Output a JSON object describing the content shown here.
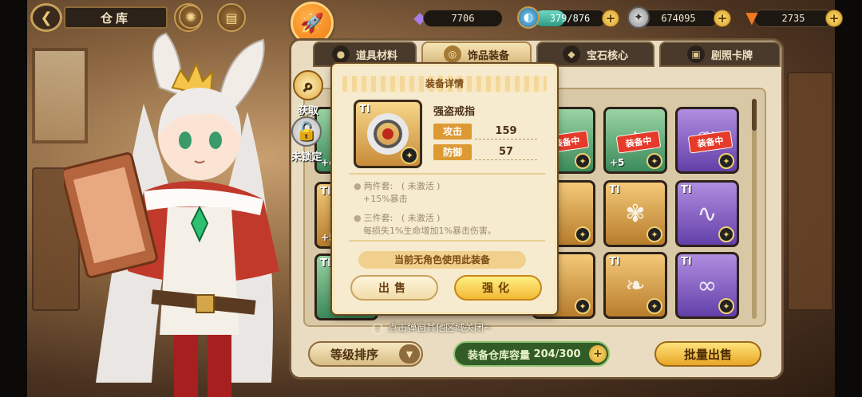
{
  "header": {
    "title": "仓库",
    "back_icon": "back-arrow-icon"
  },
  "resources": {
    "gem": {
      "icon": "purple-crystal-icon",
      "value": "7706"
    },
    "stamina": {
      "icon": "potion-icon",
      "value": "379/876",
      "fill_fraction": 0.43
    },
    "coin": {
      "icon": "silver-coin-icon",
      "value": "674095"
    },
    "carrot": {
      "icon": "carrot-icon",
      "value": "2735"
    }
  },
  "tabs": [
    {
      "label": "道具材料",
      "active": false
    },
    {
      "label": "饰品装备",
      "active": true
    },
    {
      "label": "宝石核心",
      "active": false
    },
    {
      "label": "剧照卡牌",
      "active": false
    }
  ],
  "side_actions": [
    {
      "label": "获取",
      "icon": "magnifier-icon"
    },
    {
      "label": "未锁定",
      "icon": "unlock-icon"
    }
  ],
  "slots": [
    {
      "tier": "TI",
      "color": "green",
      "equipped": "",
      "level": "",
      "icon": "bow-icon"
    },
    {
      "tier": "TI",
      "color": "green",
      "equipped": "装备中",
      "level": "",
      "icon": "leaf-crown-icon"
    },
    {
      "tier": "TI",
      "color": "green",
      "equipped": "装备中",
      "level": "+5",
      "icon": "dragon-icon"
    },
    {
      "tier": "TI",
      "color": "purple",
      "equipped": "装备中",
      "level": "",
      "icon": "horn-icon"
    },
    {
      "tier": "TI",
      "color": "gold",
      "equipped": "",
      "level": "",
      "icon": "ring-icon"
    },
    {
      "tier": "TI",
      "color": "gold",
      "equipped": "",
      "level": "",
      "icon": "fox-icon"
    },
    {
      "tier": "TI",
      "color": "purple",
      "equipped": "",
      "level": "",
      "icon": "serpent-icon"
    },
    {
      "tier": "TI",
      "color": "gold",
      "equipped": "",
      "level": "",
      "icon": "feather-icon"
    },
    {
      "tier": "TI",
      "color": "green",
      "equipped": "",
      "level": "",
      "icon": "leaf-icon"
    },
    {
      "tier": "TI",
      "color": "purple",
      "equipped": "",
      "level": "",
      "icon": "goggles-icon"
    }
  ],
  "left_column_partial": [
    {
      "level": "+4"
    },
    {
      "level": "+5"
    }
  ],
  "popup": {
    "title": "装备详情",
    "item": {
      "tier": "TI",
      "name": "强盗戒指",
      "icon": "bandit-ring-icon"
    },
    "stats": [
      {
        "label": "攻击",
        "value": "159"
      },
      {
        "label": "防御",
        "value": "57"
      }
    ],
    "set_bonuses": [
      {
        "name": "两件套:",
        "status": "( 未激活 )",
        "effect": "+15%暴击"
      },
      {
        "name": "三件套:",
        "status": "( 未激活 )",
        "effect": "每损失1%生命增加1%暴击伤害。"
      }
    ],
    "no_user_text": "当前无角色使用此装备",
    "sell_label": "出售",
    "upgrade_label": "强化"
  },
  "hint": "点击弹窗其他区域关闭~",
  "bottom": {
    "sort_label": "等级排序",
    "capacity_label": "装备仓库容量",
    "capacity_value": "204/300",
    "bulk_sell_label": "批量出售"
  }
}
